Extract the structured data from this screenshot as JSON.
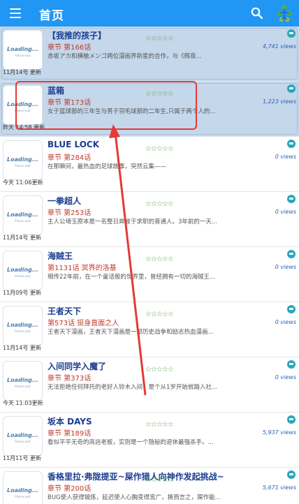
{
  "appbar": {
    "title": "首页",
    "menu_icon": "menu-icon",
    "search_icon": "search-icon",
    "tree_icon": "tree-icon"
  },
  "colors": {
    "appbar": "#2196f3",
    "title": "#1a3d8f",
    "chapter": "#c0392b",
    "views": "#2d63b3",
    "highlight": "#e53935",
    "selected": "#c4d7eb"
  },
  "thumb": {
    "loading": "Loading...",
    "wait": "Please wait"
  },
  "items": [
    {
      "name": "【我推的孩子】",
      "chapter": "章节 第166话",
      "desc": "赤坂アカ和横槍メンゴ两位漫画界新星的合作，与《辉夜...",
      "updated": "11月14号 更新",
      "views": "4,741 views",
      "selected": true,
      "stars": "☆☆☆☆☆"
    },
    {
      "name": "蓝箱",
      "chapter": "章节 第173话",
      "desc": "女子篮球部的三年生与男子羽毛球部的二年生,只属于两个人的...",
      "updated": "昨天 14:58 更新",
      "views": "1,223 views",
      "selected": true,
      "stars": "☆☆☆☆☆"
    },
    {
      "name": "BLUE LOCK",
      "chapter": "章节 第284话",
      "desc": "在那瞬间，最热血的足球故事，突然云集——",
      "updated": "今天 11:06更新",
      "views": "0 views",
      "selected": false,
      "stars": "☆☆☆☆☆"
    },
    {
      "name": "一拳超人",
      "chapter": "章节 第253话",
      "desc": "主人公埼玉原本是一名整日奔波于求职的普通人。3年前的一天...",
      "updated": "11月14号 更新",
      "views": "0 views",
      "selected": false,
      "stars": "☆☆☆☆☆"
    },
    {
      "name": "海贼王",
      "chapter": "第1131话 冥界的洛基",
      "desc": "相传22年前，在一个童话般的世界里，曾经拥有一切的海贼王...",
      "updated": "11月09号 更新",
      "views": "0 views",
      "selected": false,
      "stars": "☆☆☆☆☆"
    },
    {
      "name": "王者天下",
      "chapter": "第573话 挺身直面之人",
      "desc": "王者天下漫画，王者天下漫画是一部历史战争和励志热血漫画...",
      "updated": "11月14号 更新",
      "views": "0 views",
      "selected": false,
      "stars": "☆☆☆☆☆"
    },
    {
      "name": "入间同学入魔了",
      "chapter": "章节 第373话",
      "desc": "无法拒绝任何拜托的老好人铃木入间，是个从1岁开始就踏入社...",
      "updated": "今天 11:03更新",
      "views": "0 views",
      "selected": false,
      "stars": "☆☆☆☆☆"
    },
    {
      "name": "坂本 DAYS",
      "chapter": "章节 第189话",
      "desc": "看似平平无奇的商店老板，实则是一个隐秘的退休最强杀手。...",
      "updated": "11月11号 更新",
      "views": "5,937 views",
      "selected": false,
      "stars": "☆☆☆☆☆"
    },
    {
      "name": "香格里拉·弗陇提亚~屎作猎人向神作发起挑战~",
      "chapter": "章节 第200话",
      "desc": "BUG使人获得锻炼，延迟使人心胸变得宽广，换而言之，屎作能...",
      "updated": "",
      "views": "5,671 views",
      "selected": false,
      "stars": "☆☆☆☆☆"
    }
  ]
}
